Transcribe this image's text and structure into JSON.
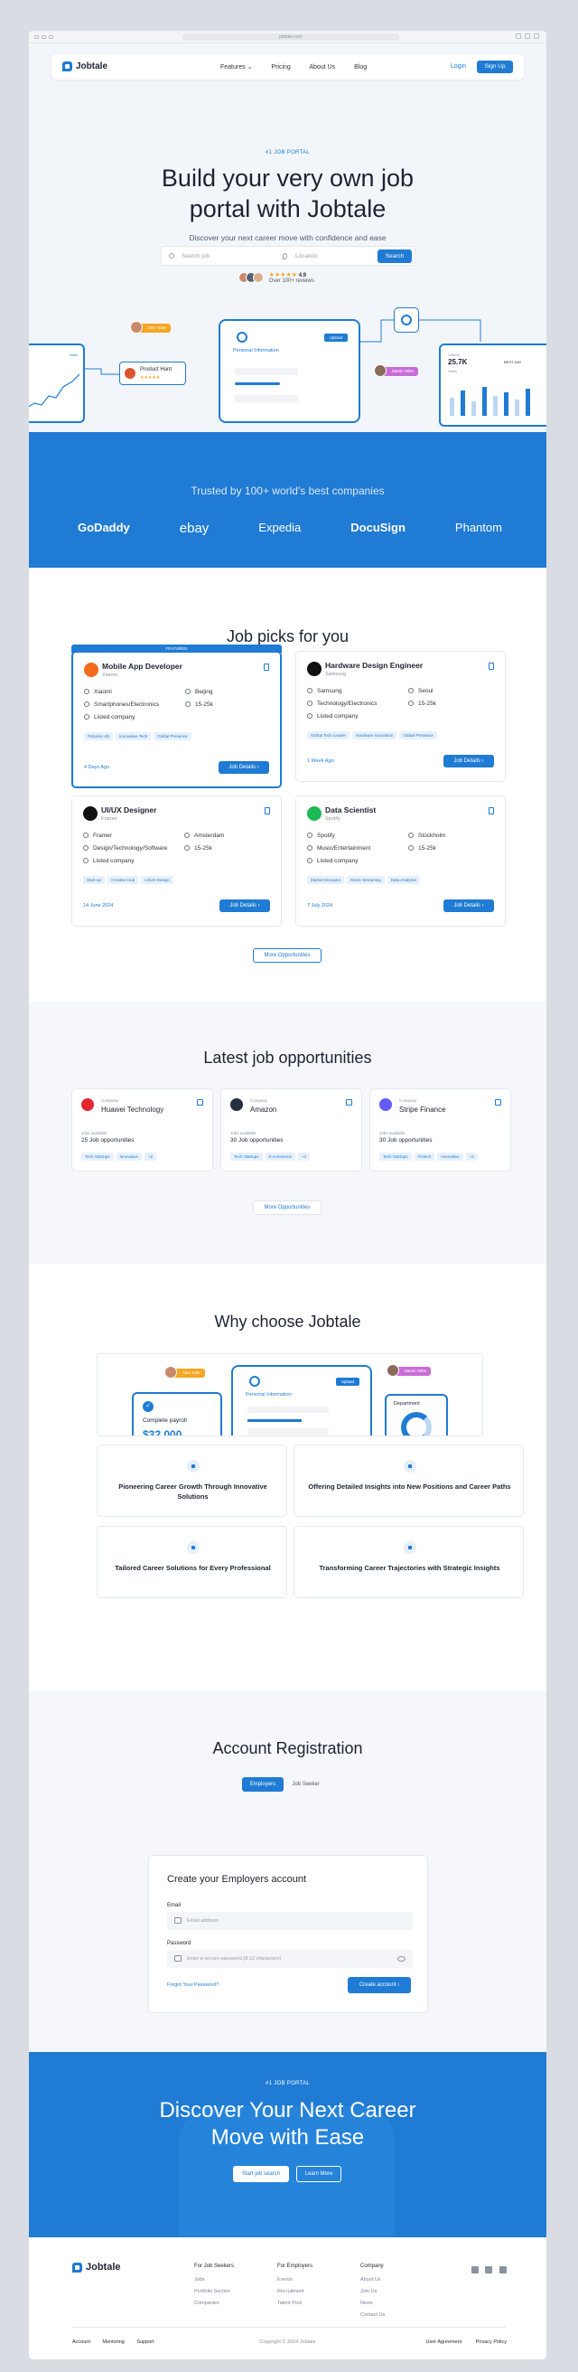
{
  "browser": {
    "url": "jobtale.com"
  },
  "nav": {
    "logo": "Jobtale",
    "items": [
      "Features",
      "Pricing",
      "About Us",
      "Blog"
    ],
    "features_chevron": "⌄",
    "login": "Login",
    "signup": "Sign Up"
  },
  "hero": {
    "eyebrow": "#1 JOB PORTAL",
    "title_line1": "Build your very own job",
    "title_line2": "portal with Jobtale",
    "subtitle": "Discover your next career move with confidence and ease",
    "search_placeholder": "Search job",
    "location_placeholder": "Location",
    "search_button": "Search",
    "rating": "4.9",
    "stars": "★★★★★",
    "reviews": "Over 100+ reviews"
  },
  "hero_illustration": {
    "badge_mentor1": "Alex Tobe",
    "product_hunt": "Product Hunt",
    "product_hunt_stars": "★★★★★",
    "personal_info": "Personal Information",
    "upload": "Upload",
    "badge_mentor2": "Martin Teller",
    "visitors_label": "Visitors",
    "visitors_value": "25.7K",
    "sales_label": "Sales",
    "week_label": "BEST DAY",
    "left_label": "Visits"
  },
  "trusted": {
    "title": "Trusted by 100+ world's best companies",
    "brands": [
      "GoDaddy",
      "ebay",
      "Expedia",
      "DocuSign",
      "Phantom"
    ]
  },
  "job_picks": {
    "title": "Job picks for you",
    "featured_label": "FEATURED",
    "listed": "Listed company",
    "details": "Job Details",
    "more": "More Opportunities",
    "jobs": [
      {
        "title": "Mobile App Developer",
        "company": "Xiaomi",
        "company2": "Xiaomi",
        "location": "Beijing",
        "industry": "Smartphones/Electronics",
        "salary": "15-25k",
        "tags": [
          "Pictures HD",
          "Innovative Tech",
          "Global Presence"
        ],
        "date": "4 Days Ago",
        "logo_color": "#f26b1d"
      },
      {
        "title": "Hardware Design Engineer",
        "company": "Samsung",
        "company2": "Samsung",
        "location": "Seoul",
        "industry": "Technology/Electronics",
        "salary": "15-25k",
        "tags": [
          "Global Tech Leader",
          "Hardware Innovation",
          "Global Presence"
        ],
        "date": "1 Week Ago",
        "logo_color": "#111111"
      },
      {
        "title": "UI/UX Designer",
        "company": "Framer",
        "company2": "Framer",
        "location": "Amsterdam",
        "industry": "Design/Technology/Software",
        "salary": "15-25k",
        "tags": [
          "Start-up",
          "Creative Hub",
          "UI/UX Design"
        ],
        "date": "14 June 2024",
        "logo_color": "#111111"
      },
      {
        "title": "Data Scientist",
        "company": "Spotify",
        "company2": "Spotify",
        "location": "Stockholm",
        "industry": "Music/Entertainment",
        "salary": "15-25k",
        "tags": [
          "Market Disruptor",
          "Music Streaming",
          "Data Analytics"
        ],
        "date": "7 July 2024",
        "logo_color": "#1db954"
      }
    ]
  },
  "latest": {
    "title": "Latest job opportunities",
    "company_label": "Company",
    "jobs_available": "Jobs available",
    "more": "More Opportunities",
    "companies": [
      {
        "name": "Huawei Technology",
        "count": "25 Job opportunities",
        "tags": [
          "Tech Startups",
          "Innovative",
          "+2"
        ],
        "color": "#e3262f"
      },
      {
        "name": "Amazon",
        "count": "30 Job opportunities",
        "tags": [
          "Tech Startups",
          "E-commerce",
          "+2"
        ],
        "color": "#232f3e"
      },
      {
        "name": "Stripe Finance",
        "count": "30 Job opportunities",
        "tags": [
          "Tech Startups",
          "Fintech",
          "Innovative",
          "+2"
        ],
        "color": "#635bff"
      }
    ]
  },
  "why": {
    "title": "Why choose Jobtale",
    "badge_mentor1": "Alex Tobe",
    "badge_mentor2": "Martin Teller",
    "payroll_label": "Complete payroll",
    "payroll_value": "$32.000",
    "personal_info": "Personal Information",
    "upload": "Upload",
    "department": "Department",
    "cards": [
      "Pioneering Career Growth Through Innovative Solutions",
      "Offering Detailed Insights into New Positions and Career Paths",
      "Tailored Career Solutions for Every Professional",
      "Transforming Career Trajectories with Strategic Insights"
    ]
  },
  "registration": {
    "title": "Account Registration",
    "tabs": [
      "Employers",
      "Job Seeker"
    ],
    "card_title": "Create your Employers account",
    "email_label": "Email",
    "email_placeholder": "Email address",
    "password_label": "Password",
    "password_placeholder": "Enter a secure password (8-12 characters)",
    "forgot": "Forgot Your Password?",
    "create": "Create account"
  },
  "cta": {
    "eyebrow": "#1 JOB PORTAL",
    "title_line1": "Discover Your Next Career",
    "title_line2": "Move with Ease",
    "start": "Start job search",
    "learn": "Learn More"
  },
  "footer": {
    "logo": "Jobtale",
    "cols": [
      {
        "title": "For Job Seekers",
        "items": [
          "Jobs",
          "Portfolio Section",
          "Companies"
        ]
      },
      {
        "title": "For Employers",
        "items": [
          "Events",
          "Recruitment",
          "Talent Pool"
        ]
      },
      {
        "title": "Company",
        "items": [
          "About Us",
          "Join Us",
          "News",
          "Contact Us"
        ]
      }
    ],
    "bottom_links": [
      "Account",
      "Mentoring",
      "Support"
    ],
    "copyright": "Copyright © 2024 Jobtale",
    "legal": [
      "User Agreement",
      "Privacy Policy"
    ]
  },
  "colors": {
    "primary": "#1f7bd3",
    "accent_orange": "#f5a623",
    "accent_pink": "#c86dd7"
  }
}
